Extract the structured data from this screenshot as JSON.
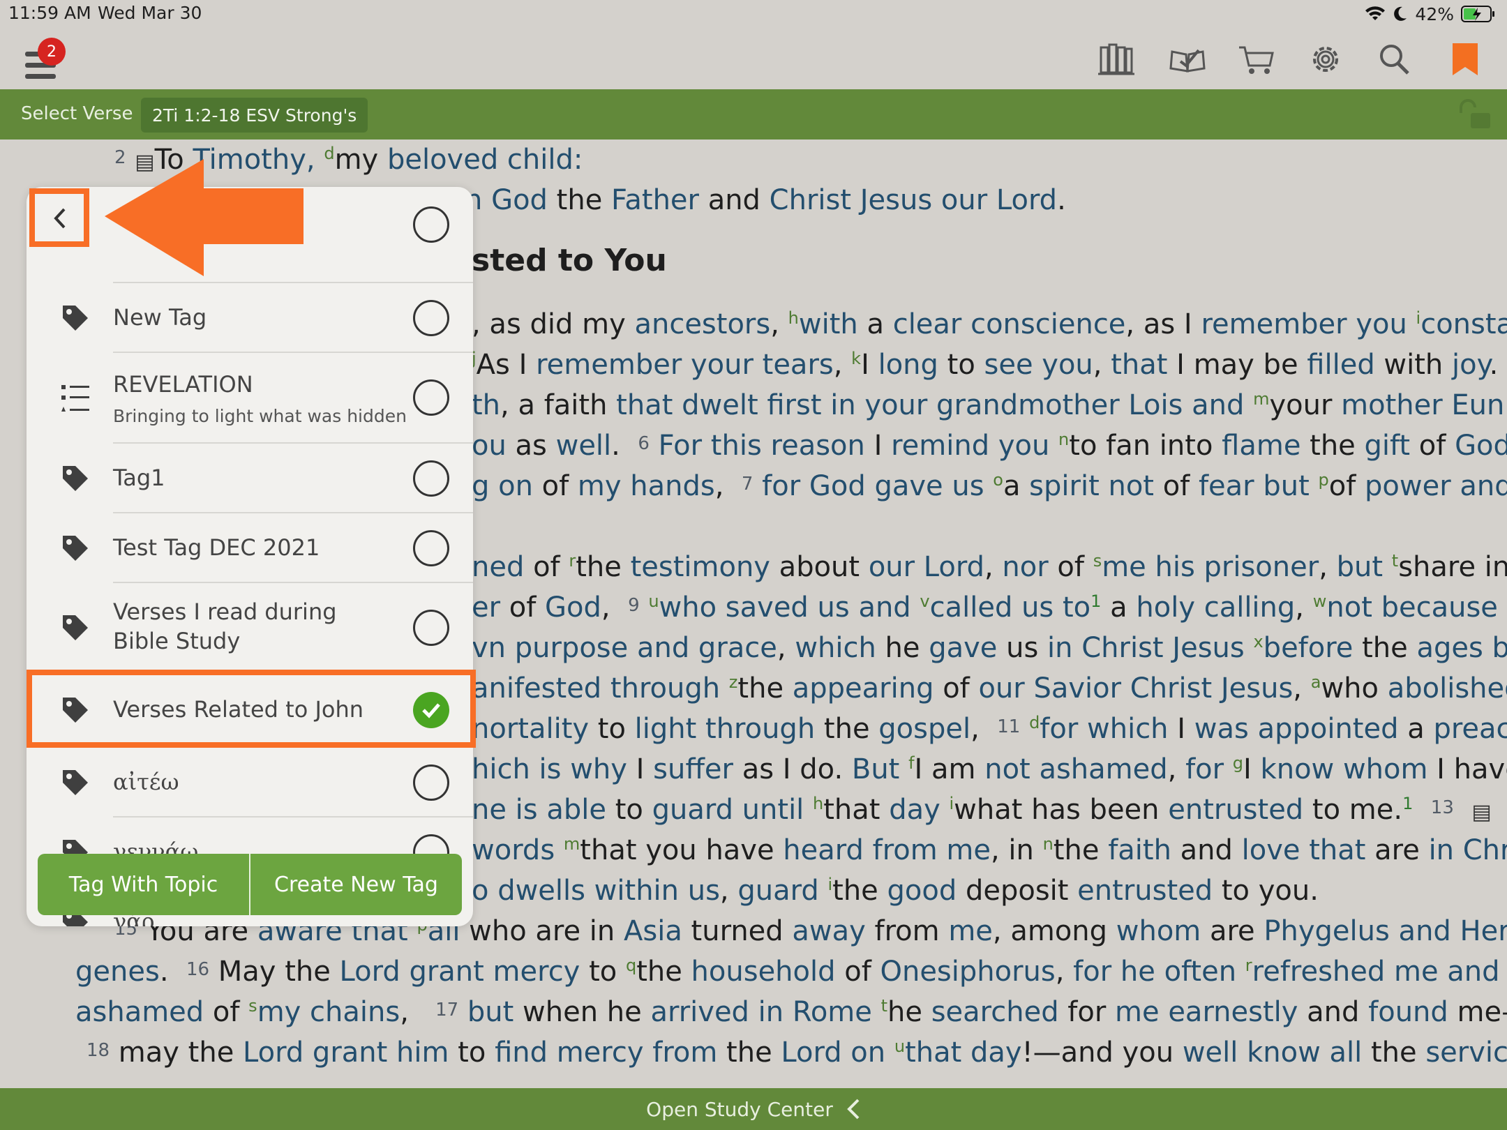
{
  "status": {
    "time": "11:59 AM",
    "date": "Wed Mar 30",
    "battery": "42%"
  },
  "toolbar": {
    "menu_badge": "2",
    "icons": [
      "library-icon",
      "reading-plan-icon",
      "cart-icon",
      "settings-icon",
      "search-icon",
      "bookmark-icon"
    ]
  },
  "verse_bar": {
    "select_label": "Select Verse",
    "reference": "2Ti 1:2-18 ESV Strong's"
  },
  "panel": {
    "partial_top": "...",
    "items": [
      {
        "title": "New Tag",
        "subtitle": "",
        "icon": "tag-icon",
        "checked": false
      },
      {
        "title": "REVELATION",
        "subtitle": "Bringing to light what was hidden",
        "icon": "list-icon",
        "checked": false
      },
      {
        "title": "Tag1",
        "subtitle": "",
        "icon": "tag-icon",
        "checked": false
      },
      {
        "title": "Test Tag DEC 2021",
        "subtitle": "",
        "icon": "tag-icon",
        "checked": false
      },
      {
        "title": "Verses I read during",
        "title2": "Bible Study",
        "subtitle": "",
        "icon": "tag-icon",
        "checked": false
      },
      {
        "title": "Verses Related to John",
        "subtitle": "",
        "icon": "tag-icon",
        "checked": true
      },
      {
        "title": "αἰτέω",
        "subtitle": "",
        "icon": "tag-icon",
        "checked": false
      },
      {
        "title": "γεννάω",
        "subtitle": "",
        "icon": "tag-icon",
        "checked": false
      },
      {
        "title": "γάρ",
        "subtitle": "",
        "icon": "tag-icon",
        "checked": false
      }
    ],
    "tag_with_topic": "Tag With Topic",
    "create_new_tag": "Create New Tag"
  },
  "bible": {
    "heading": "sted to You",
    "lines": {
      "l2a": "To",
      "l2b": "Timothy,",
      "l2c": "my",
      "l2d": "beloved child:",
      "l3a": "n God",
      "l3b": "the",
      "l3c": "Father",
      "l3d": "and",
      "l3e": "Christ Jesus our Lord",
      "l3f": "."
    }
  },
  "bottom": {
    "study_center": "Open Study Center"
  },
  "colors": {
    "green_bar": "#62893a",
    "annotation_orange": "#f86e26",
    "check_green": "#4aa521",
    "link_blue": "#234e6e"
  }
}
